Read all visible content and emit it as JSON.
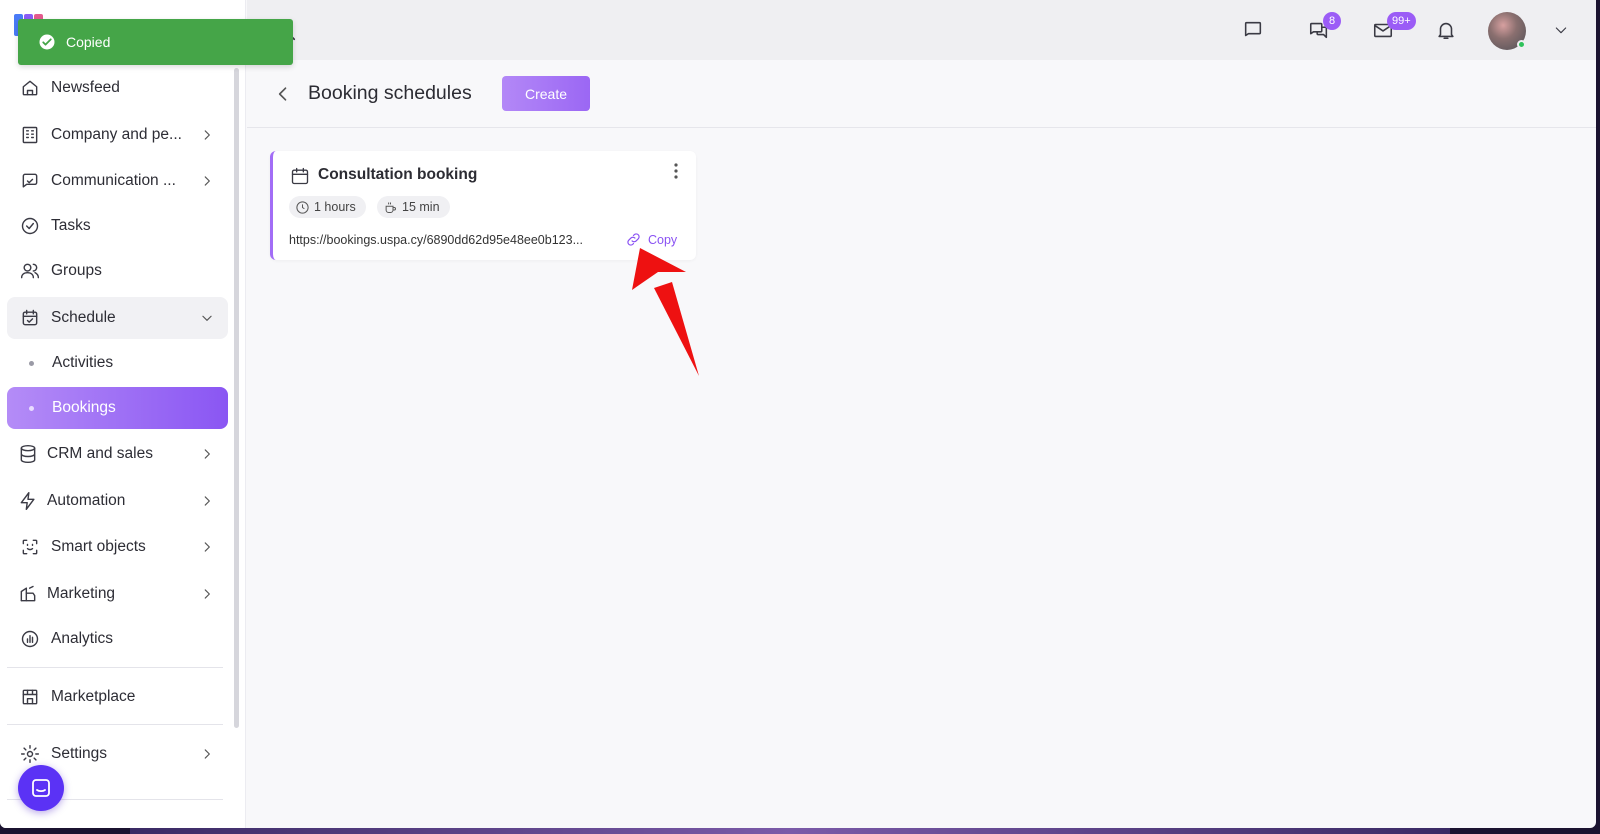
{
  "toast": {
    "message": "Copied"
  },
  "sidebar": {
    "items": [
      {
        "label": "Newsfeed",
        "icon": "home-icon"
      },
      {
        "label": "Company and pe...",
        "icon": "building-icon"
      },
      {
        "label": "Communication ...",
        "icon": "chat-icon"
      },
      {
        "label": "Tasks",
        "icon": "check-circle-icon"
      },
      {
        "label": "Groups",
        "icon": "users-icon"
      },
      {
        "label": "Schedule",
        "icon": "calendar-check-icon"
      },
      {
        "label": "CRM and sales",
        "icon": "database-icon"
      },
      {
        "label": "Automation",
        "icon": "bolt-icon"
      },
      {
        "label": "Smart objects",
        "icon": "scan-face-icon"
      },
      {
        "label": "Marketing",
        "icon": "marketing-icon"
      },
      {
        "label": "Analytics",
        "icon": "chart-icon"
      },
      {
        "label": "Marketplace",
        "icon": "store-icon"
      },
      {
        "label": "Settings",
        "icon": "gear-icon"
      }
    ],
    "schedule_sub": [
      {
        "label": "Activities"
      },
      {
        "label": "Bookings",
        "active": true
      }
    ]
  },
  "topbar": {
    "badges": {
      "chats": "8",
      "mail": "99+"
    }
  },
  "page": {
    "title": "Booking schedules",
    "create_label": "Create"
  },
  "booking_card": {
    "title": "Consultation booking",
    "duration": "1 hours",
    "buffer": "15 min",
    "url": "https://bookings.uspa.cy/6890dd62d95e48ee0b123...",
    "copy_label": "Copy"
  },
  "colors": {
    "accent": "#9b5cf6",
    "toast_green": "#45a548",
    "annotation_red": "#ee1111",
    "chat_launcher": "#5b32f5"
  }
}
